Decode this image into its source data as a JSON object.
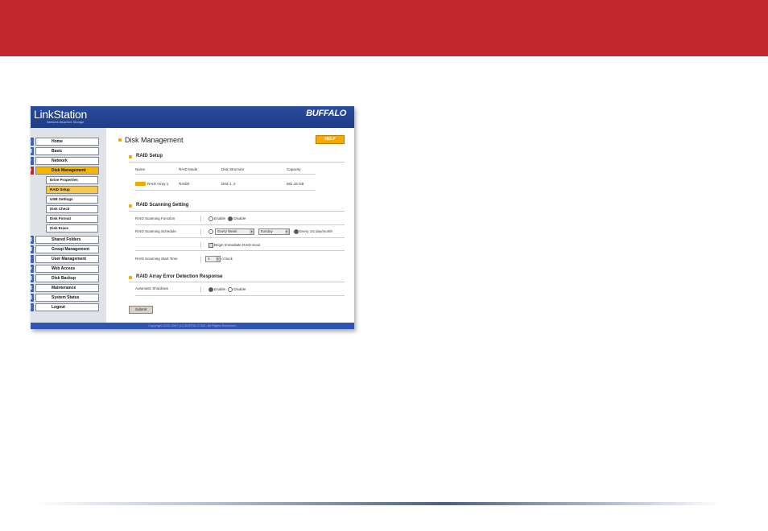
{
  "screenshot": {
    "header": {
      "logo": "LinkStation",
      "tagline": "Network Attached Storage",
      "brand": "BUFFALO"
    },
    "sidebar": {
      "items": [
        {
          "label": "Home",
          "icon": "home-icon",
          "glyph": "⌂"
        },
        {
          "label": "Basic",
          "icon": "basic-icon",
          "glyph": "▣"
        },
        {
          "label": "Network",
          "icon": "network-icon",
          "glyph": "✦"
        },
        {
          "label": "Disk Management",
          "icon": "disk-icon",
          "glyph": "■",
          "active": true
        },
        {
          "label": "Shared Folders",
          "icon": "folder-icon",
          "glyph": "▤"
        },
        {
          "label": "Group Management",
          "icon": "group-icon",
          "glyph": "▦"
        },
        {
          "label": "User Management",
          "icon": "user-icon",
          "glyph": "☺"
        },
        {
          "label": "Web Access",
          "icon": "web-icon",
          "glyph": "◉"
        },
        {
          "label": "Disk Backup",
          "icon": "backup-icon",
          "glyph": "▥"
        },
        {
          "label": "Maintenance",
          "icon": "maintenance-icon",
          "glyph": "▧"
        },
        {
          "label": "System Status",
          "icon": "status-icon",
          "glyph": "▨"
        },
        {
          "label": "Logout",
          "icon": "logout-icon",
          "glyph": "▮"
        }
      ],
      "subitems": [
        {
          "label": "Drive Properties"
        },
        {
          "label": "RAID Setup",
          "active": true
        },
        {
          "label": "USB Settings"
        },
        {
          "label": "Disk Check"
        },
        {
          "label": "Disk Format"
        },
        {
          "label": "Disk Erase"
        }
      ]
    },
    "main": {
      "title": "Disk Management",
      "help": "HELP",
      "raid_setup": {
        "heading": "RAID Setup",
        "columns": [
          "Name",
          "RAID Mode",
          "Disk Structure",
          "Capacity"
        ],
        "row": [
          "RAID Array 1",
          "RAID0",
          "Disk 1, 2",
          "581.16 GB"
        ]
      },
      "scanning": {
        "heading": "RAID Scanning Setting",
        "function_label": "RAID Scanning Function",
        "enable": "Enable",
        "disable": "Disable",
        "schedule_label": "RAID Scanning Schedule",
        "freq": "Every Week",
        "day": "Sunday",
        "monthly": "Every 1st day/month",
        "immediate": "Begin Immediate RAID Scan",
        "start_label": "RAID Scanning Start Time",
        "hour": "3",
        "oclock": "o'clock"
      },
      "error": {
        "heading": "RAID Array Error Detection Response",
        "shutdown_label": "Automatic Shutdown",
        "enable": "Enable",
        "disable": "Disable"
      },
      "submit": "Submit"
    },
    "footer": "Copyright 2002-2007 (C) BUFFALO INC. All Rights Reserved."
  },
  "colors": {
    "banner": "#c1272d",
    "nav_active": "#f6b500",
    "header": "#1e3c86"
  }
}
